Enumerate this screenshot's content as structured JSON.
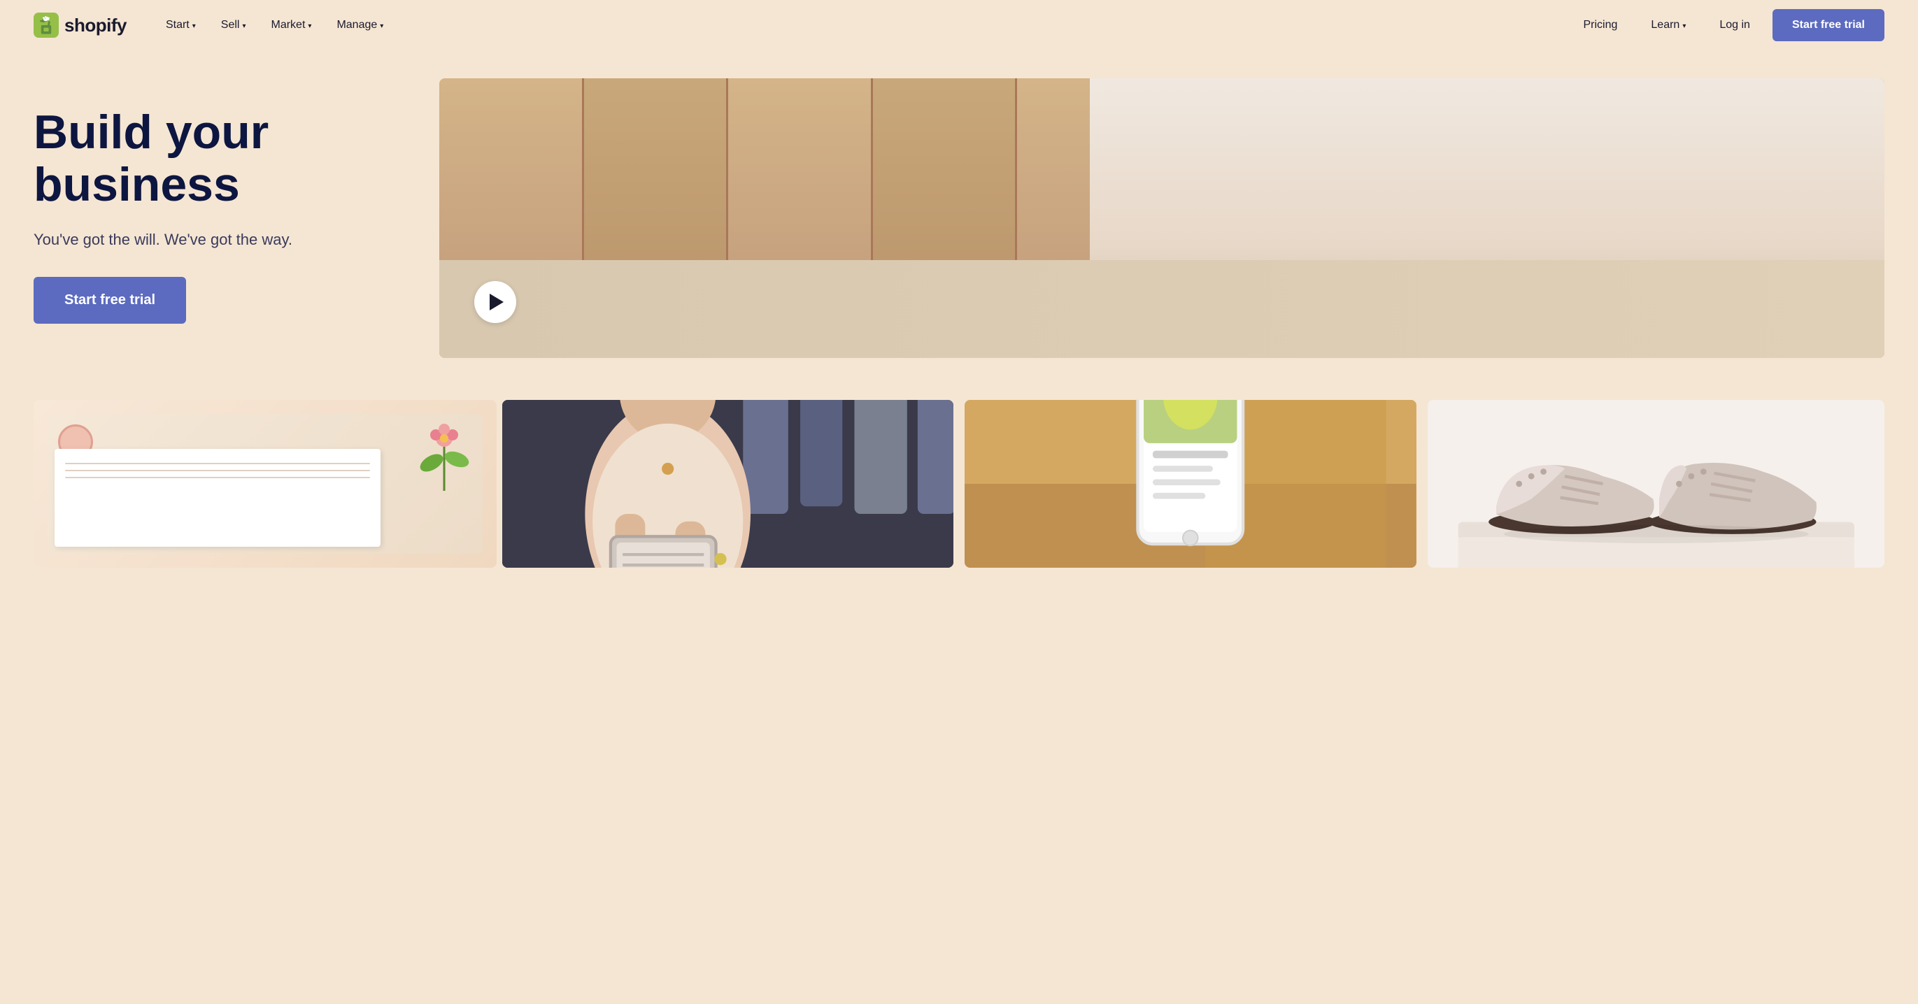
{
  "brand": {
    "name": "shopify",
    "logo_alt": "Shopify logo"
  },
  "nav": {
    "links": [
      {
        "label": "Start",
        "has_dropdown": true
      },
      {
        "label": "Sell",
        "has_dropdown": true
      },
      {
        "label": "Market",
        "has_dropdown": true
      },
      {
        "label": "Manage",
        "has_dropdown": true
      }
    ],
    "right_links": [
      {
        "label": "Pricing"
      },
      {
        "label": "Learn",
        "has_dropdown": true
      },
      {
        "label": "Log in"
      }
    ],
    "cta_label": "Start free trial"
  },
  "hero": {
    "title": "Build your business",
    "subtitle": "You've got the will. We've got the way.",
    "cta_label": "Start free trial"
  },
  "grid": {
    "cells": [
      {
        "alt": "Notepad and coffee scene"
      },
      {
        "alt": "Person with tablet browsing clothes rack"
      },
      {
        "alt": "Hand holding phone with Shopify store"
      },
      {
        "alt": "Oxford shoes on display"
      }
    ]
  }
}
